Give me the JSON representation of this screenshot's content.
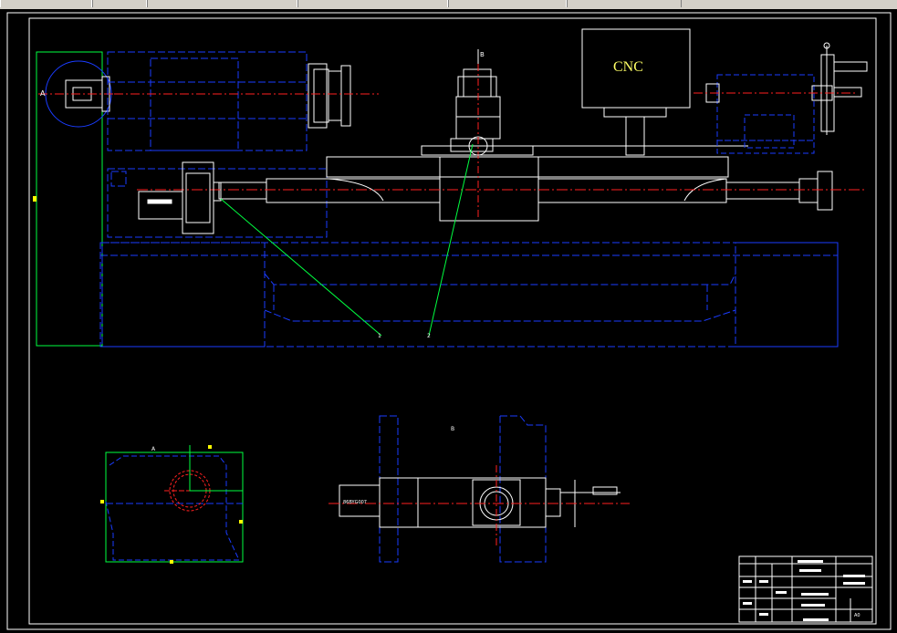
{
  "app": {
    "toolbar_segments": 6
  },
  "drawing": {
    "cnc_label": "CNC",
    "callouts": {
      "view_a_top": "A",
      "view_b_top": "B",
      "leader_1": "1",
      "leader_2": "2",
      "view_a_bottom": "A",
      "view_b_bottom": "B"
    },
    "motor_label": "86BYG007",
    "sheet_size": "A0"
  },
  "colors": {
    "background": "#000000",
    "white": "#ffffff",
    "blue": "#1a3cff",
    "red": "#ff2020",
    "green": "#00ff40",
    "yellow": "#ffff00",
    "cnc_text": "#ffff66"
  }
}
